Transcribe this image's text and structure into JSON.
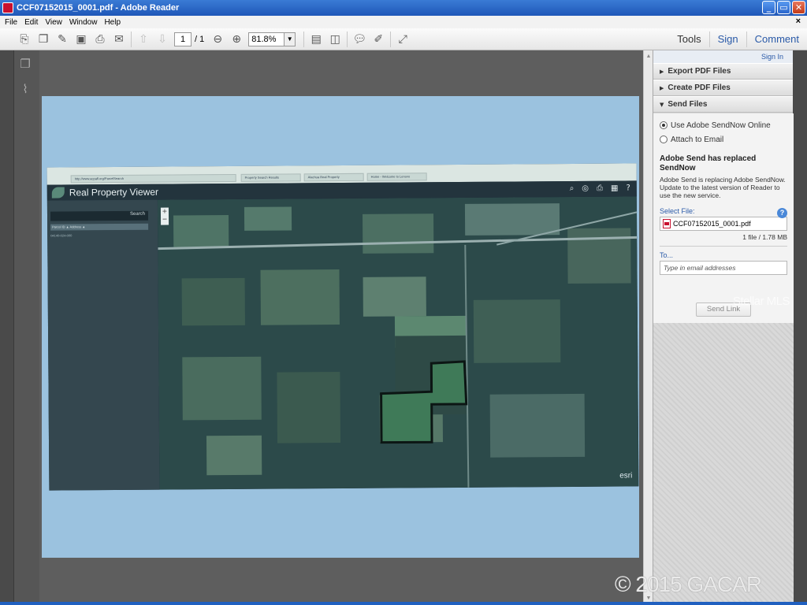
{
  "window": {
    "title": "CCF07152015_0001.pdf - Adobe Reader",
    "controls": {
      "minimize": "_",
      "restore": "▭",
      "close": "✕"
    }
  },
  "menubar": {
    "items": [
      "File",
      "Edit",
      "View",
      "Window",
      "Help"
    ],
    "close_glyph": "×"
  },
  "toolbar": {
    "page_current": "1",
    "page_total": "/ 1",
    "zoom": "81.8%",
    "right_links": [
      "Tools",
      "Sign",
      "Comment"
    ]
  },
  "document": {
    "scan": {
      "tabs": [
        "http://www.acpafl.org/ParcelSearch",
        "Property Search Results",
        "Alachua Real Property",
        "Home - Welcome to Lenovo"
      ],
      "app_title": "Real Property Viewer",
      "search_label": "Search",
      "columns": "Parcel ID  ▲     Address  ▲",
      "result_row": "04140-024-000",
      "zoom_plus": "+",
      "zoom_minus": "−",
      "esri": "esri"
    }
  },
  "right_panel": {
    "sign_in": "Sign In",
    "sections": [
      {
        "label": "Export PDF Files",
        "expanded": false
      },
      {
        "label": "Create PDF Files",
        "expanded": false
      },
      {
        "label": "Send Files",
        "expanded": true
      }
    ],
    "send": {
      "option_online": "Use Adobe SendNow Online",
      "option_email": "Attach to Email",
      "replaced_title": "Adobe Send has replaced SendNow",
      "replaced_text": "Adobe Send is replacing Adobe SendNow. Update to the latest version of Reader to use the new service.",
      "select_file_label": "Select File:",
      "file_name": "CCF07152015_0001.pdf",
      "file_meta": "1 file / 1.78 MB",
      "to_label": "To...",
      "email_placeholder": "Type in email addresses",
      "send_button": "Send Link"
    }
  },
  "watermarks": {
    "stellar": "Stellar MLS",
    "copyright": "© 2015 GACAR"
  },
  "colors": {
    "titlebar": "#1f57b8",
    "page_bg": "#9bc2df",
    "link_blue": "#2a5aa8"
  }
}
